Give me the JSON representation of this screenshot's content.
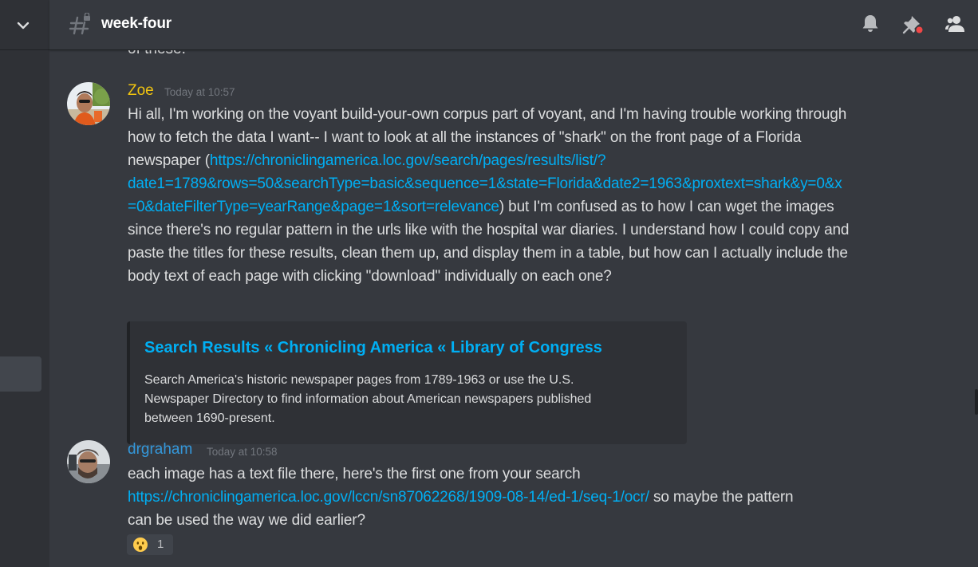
{
  "header": {
    "channel_name": "week-four",
    "icons": [
      "chevron-down-icon",
      "hash-icon",
      "bell-icon",
      "pin-icon",
      "members-icon"
    ]
  },
  "scroll_fragment": "of these.",
  "messages": [
    {
      "author": "Zoe",
      "author_color": "#f1c40f",
      "timestamp": "Today at 10:57",
      "line1": "Hi all, I'm working on the voyant build-your-own corpus part of voyant, and I'm having trouble working through",
      "line2": "how to fetch the data I want-- I want to look at all the instances of \"shark\" on the front page of a Florida",
      "line3_pre": "newspaper (",
      "link_part1": "https://chroniclingamerica.loc.gov/search/pages/results/list/?",
      "link_part2": "date1=1789&rows=50&searchType=basic&sequence=1&state=Florida&date2=1963&proxtext=shark&y=0&x",
      "link_part3": "=0&dateFilterType=yearRange&page=1&sort=relevance",
      "line5_post": ") but I'm confused as to how I can wget the images",
      "line6": "since there's no regular pattern  in the urls like with the hospital war diaries. I understand how I could copy and",
      "line7": "paste the titles for these results, clean them up, and display them in a table, but how can I actually include the",
      "line8": "body text of each page with clicking \"download\" individually on each one?",
      "embed": {
        "title": "Search Results « Chronicling America « Library of Congress",
        "description_line1": "Search America's historic newspaper pages from 1789-1963 or use the U.S.",
        "description_line2": "Newspaper Directory to find information about American newspapers published",
        "description_line3": "between 1690-present."
      }
    },
    {
      "author": "drgraham",
      "author_color": "#3498db",
      "timestamp": "Today at 10:58",
      "line1": "each image has a text file there, here's the first one from your search",
      "link": "https://chroniclingamerica.loc.gov/lccn/sn87062268/1909-08-14/ed-1/seq-1/ocr/",
      "line2_post": " so maybe the pattern",
      "line3": "can be used the way we did earlier?",
      "reaction": {
        "emoji": "hushed-face-icon",
        "count": "1"
      }
    }
  ],
  "colors": {
    "background": "#36393f",
    "sidebar": "#2f3136",
    "link": "#00aff4",
    "muted": "#72767d",
    "notification_dot": "#f04747"
  }
}
